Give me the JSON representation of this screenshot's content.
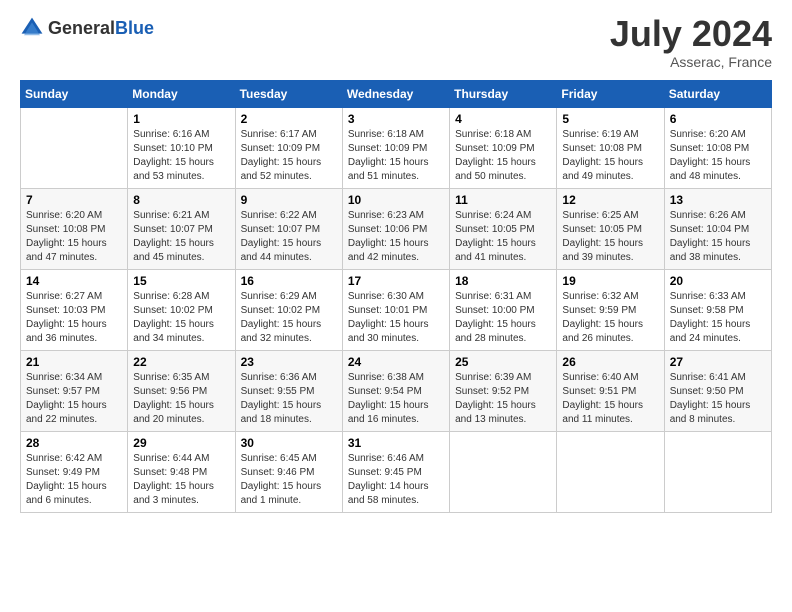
{
  "header": {
    "logo_general": "General",
    "logo_blue": "Blue",
    "month_year": "July 2024",
    "location": "Asserac, France"
  },
  "calendar": {
    "days_of_week": [
      "Sunday",
      "Monday",
      "Tuesday",
      "Wednesday",
      "Thursday",
      "Friday",
      "Saturday"
    ],
    "weeks": [
      [
        {
          "day": "",
          "content": ""
        },
        {
          "day": "1",
          "content": "Sunrise: 6:16 AM\nSunset: 10:10 PM\nDaylight: 15 hours\nand 53 minutes."
        },
        {
          "day": "2",
          "content": "Sunrise: 6:17 AM\nSunset: 10:09 PM\nDaylight: 15 hours\nand 52 minutes."
        },
        {
          "day": "3",
          "content": "Sunrise: 6:18 AM\nSunset: 10:09 PM\nDaylight: 15 hours\nand 51 minutes."
        },
        {
          "day": "4",
          "content": "Sunrise: 6:18 AM\nSunset: 10:09 PM\nDaylight: 15 hours\nand 50 minutes."
        },
        {
          "day": "5",
          "content": "Sunrise: 6:19 AM\nSunset: 10:08 PM\nDaylight: 15 hours\nand 49 minutes."
        },
        {
          "day": "6",
          "content": "Sunrise: 6:20 AM\nSunset: 10:08 PM\nDaylight: 15 hours\nand 48 minutes."
        }
      ],
      [
        {
          "day": "7",
          "content": "Sunrise: 6:20 AM\nSunset: 10:08 PM\nDaylight: 15 hours\nand 47 minutes."
        },
        {
          "day": "8",
          "content": "Sunrise: 6:21 AM\nSunset: 10:07 PM\nDaylight: 15 hours\nand 45 minutes."
        },
        {
          "day": "9",
          "content": "Sunrise: 6:22 AM\nSunset: 10:07 PM\nDaylight: 15 hours\nand 44 minutes."
        },
        {
          "day": "10",
          "content": "Sunrise: 6:23 AM\nSunset: 10:06 PM\nDaylight: 15 hours\nand 42 minutes."
        },
        {
          "day": "11",
          "content": "Sunrise: 6:24 AM\nSunset: 10:05 PM\nDaylight: 15 hours\nand 41 minutes."
        },
        {
          "day": "12",
          "content": "Sunrise: 6:25 AM\nSunset: 10:05 PM\nDaylight: 15 hours\nand 39 minutes."
        },
        {
          "day": "13",
          "content": "Sunrise: 6:26 AM\nSunset: 10:04 PM\nDaylight: 15 hours\nand 38 minutes."
        }
      ],
      [
        {
          "day": "14",
          "content": "Sunrise: 6:27 AM\nSunset: 10:03 PM\nDaylight: 15 hours\nand 36 minutes."
        },
        {
          "day": "15",
          "content": "Sunrise: 6:28 AM\nSunset: 10:02 PM\nDaylight: 15 hours\nand 34 minutes."
        },
        {
          "day": "16",
          "content": "Sunrise: 6:29 AM\nSunset: 10:02 PM\nDaylight: 15 hours\nand 32 minutes."
        },
        {
          "day": "17",
          "content": "Sunrise: 6:30 AM\nSunset: 10:01 PM\nDaylight: 15 hours\nand 30 minutes."
        },
        {
          "day": "18",
          "content": "Sunrise: 6:31 AM\nSunset: 10:00 PM\nDaylight: 15 hours\nand 28 minutes."
        },
        {
          "day": "19",
          "content": "Sunrise: 6:32 AM\nSunset: 9:59 PM\nDaylight: 15 hours\nand 26 minutes."
        },
        {
          "day": "20",
          "content": "Sunrise: 6:33 AM\nSunset: 9:58 PM\nDaylight: 15 hours\nand 24 minutes."
        }
      ],
      [
        {
          "day": "21",
          "content": "Sunrise: 6:34 AM\nSunset: 9:57 PM\nDaylight: 15 hours\nand 22 minutes."
        },
        {
          "day": "22",
          "content": "Sunrise: 6:35 AM\nSunset: 9:56 PM\nDaylight: 15 hours\nand 20 minutes."
        },
        {
          "day": "23",
          "content": "Sunrise: 6:36 AM\nSunset: 9:55 PM\nDaylight: 15 hours\nand 18 minutes."
        },
        {
          "day": "24",
          "content": "Sunrise: 6:38 AM\nSunset: 9:54 PM\nDaylight: 15 hours\nand 16 minutes."
        },
        {
          "day": "25",
          "content": "Sunrise: 6:39 AM\nSunset: 9:52 PM\nDaylight: 15 hours\nand 13 minutes."
        },
        {
          "day": "26",
          "content": "Sunrise: 6:40 AM\nSunset: 9:51 PM\nDaylight: 15 hours\nand 11 minutes."
        },
        {
          "day": "27",
          "content": "Sunrise: 6:41 AM\nSunset: 9:50 PM\nDaylight: 15 hours\nand 8 minutes."
        }
      ],
      [
        {
          "day": "28",
          "content": "Sunrise: 6:42 AM\nSunset: 9:49 PM\nDaylight: 15 hours\nand 6 minutes."
        },
        {
          "day": "29",
          "content": "Sunrise: 6:44 AM\nSunset: 9:48 PM\nDaylight: 15 hours\nand 3 minutes."
        },
        {
          "day": "30",
          "content": "Sunrise: 6:45 AM\nSunset: 9:46 PM\nDaylight: 15 hours\nand 1 minute."
        },
        {
          "day": "31",
          "content": "Sunrise: 6:46 AM\nSunset: 9:45 PM\nDaylight: 14 hours\nand 58 minutes."
        },
        {
          "day": "",
          "content": ""
        },
        {
          "day": "",
          "content": ""
        },
        {
          "day": "",
          "content": ""
        }
      ]
    ]
  }
}
